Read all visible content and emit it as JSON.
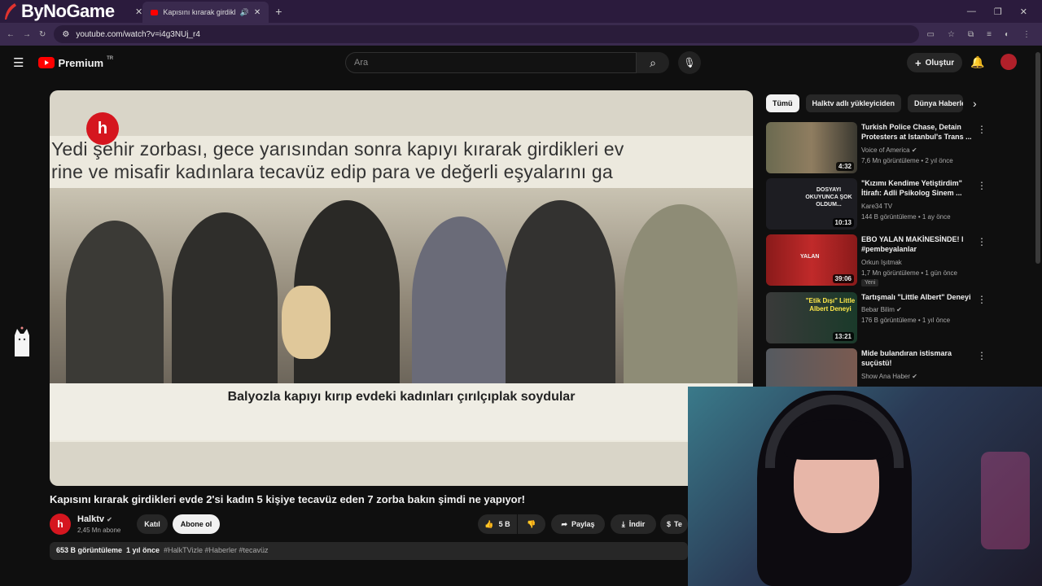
{
  "browser": {
    "logo": "ByNoGame",
    "tabs": [
      {
        "title": "Kapısını kırarak girdikleri ev"
      }
    ],
    "url": "youtube.com/watch?v=i4g3NUj_r4"
  },
  "yt": {
    "brand": "Premium",
    "region": "TR",
    "search_placeholder": "Ara",
    "create_label": "Oluştur"
  },
  "video": {
    "headline_line1": "Yedi şehir zorbası, gece yarısından sonra kapıyı kırarak girdikleri ev",
    "headline_line2": "rine ve misafir kadınlara  tecavüz edip para ve değerli eşyalarını ga",
    "caption": "Balyozla kapıyı kırıp evdeki kadınları çırılçıplak soydular",
    "title": "Kapısını kırarak girdikleri evde 2'si kadın 5 kişiye tecavüz eden 7 zorba bakın şimdi ne yapıyor!",
    "channel": "Halktv",
    "subscribers": "2,45 Mn abone",
    "join_label": "Katıl",
    "subscribe_label": "Abone ol",
    "likes": "5 B",
    "share_label": "Paylaş",
    "download_label": "İndir",
    "thanks_label": "Te",
    "views": "653 B görüntüleme",
    "age": "1 yıl önce",
    "tags": "#HalkTVizle #Haberler #tecavüz"
  },
  "chips": [
    "Tümü",
    "Halktv adlı yükleyiciden",
    "Dünya Haberle"
  ],
  "recommendations": [
    {
      "title": "Turkish Police Chase, Detain Protesters at Istanbul's Trans ...",
      "channel": "Voice of America",
      "meta": "7,6 Mn görüntüleme • 2 yıl önce",
      "duration": "4:32",
      "thumb_color": "#6b6a50"
    },
    {
      "title": "\"Kızımı Kendime Yetiştirdim\" İtirafı: Adli Psikolog Sinem ...",
      "channel": "Kare34 TV",
      "meta": "144 B görüntüleme • 1 ay önce",
      "duration": "10:13",
      "thumb_color": "#1d1d22",
      "thumb_text": "DOSYAYI OKUYUNCA ŞOK OLDUM..."
    },
    {
      "title": "EBO YALAN MAKİNESİNDE! l #pembeyalanlar",
      "channel": "Orkun Işıtmak",
      "meta": "1,7 Mn görüntüleme • 1 gün önce",
      "duration": "39:06",
      "thumb_color": "#8a1a1a",
      "badge": "Yeni",
      "thumb_text": "YALAN"
    },
    {
      "title": "Tartışmalı \"Little Albert\" Deneyi",
      "channel": "Bebar Bilim",
      "meta": "176 B görüntüleme • 1 yıl önce",
      "duration": "13:21",
      "thumb_color": "#1a3a2a",
      "thumb_text": "\"Etik Dışı\" Little Albert Deneyi"
    },
    {
      "title": "Mide bulandıran istismara suçüstü!",
      "channel": "Show Ana Haber",
      "meta": "",
      "duration": "",
      "thumb_color": "#555a60"
    }
  ]
}
